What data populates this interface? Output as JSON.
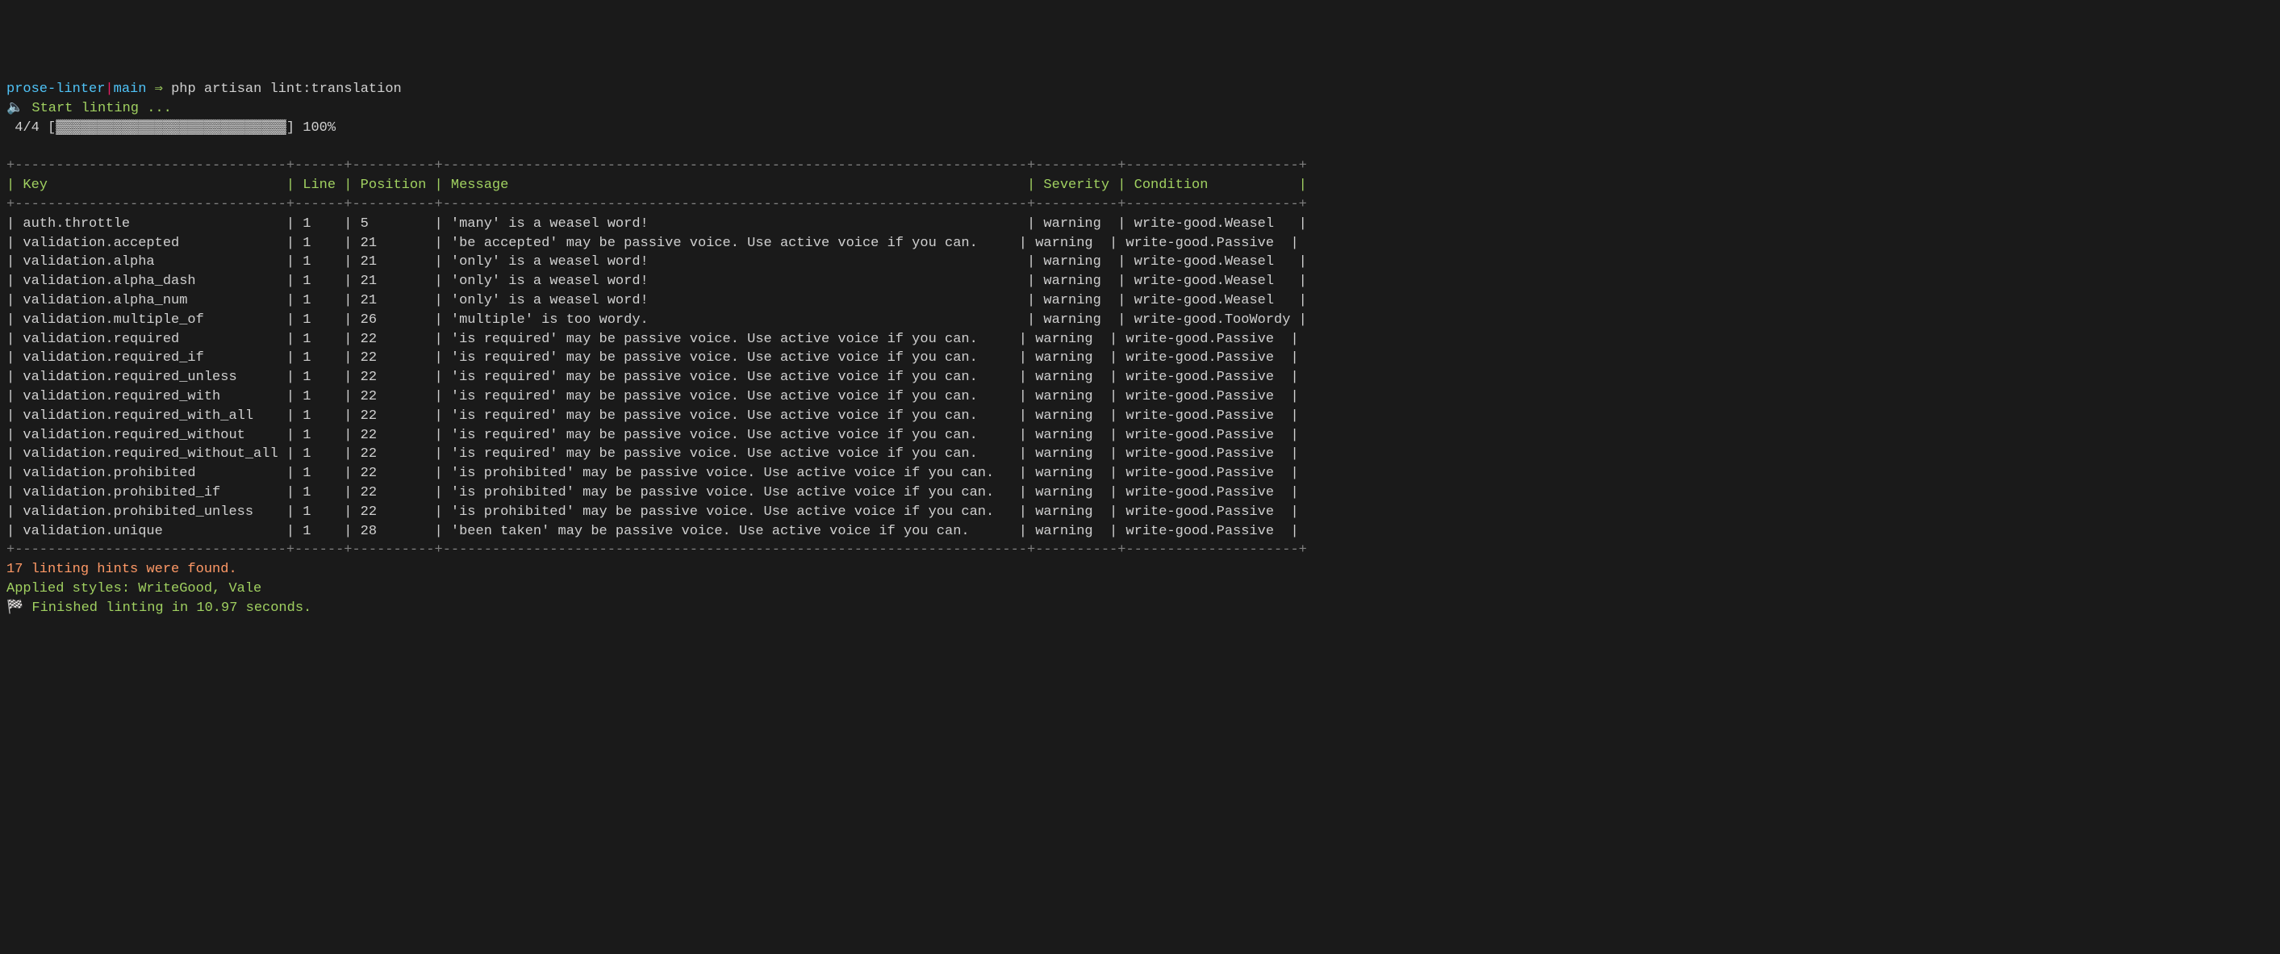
{
  "prompt": {
    "dir": "prose-linter",
    "pipe": "|",
    "branch": "main",
    "arrow": " ⇒ ",
    "command": "php artisan lint:translation"
  },
  "start": {
    "icon": "🔈",
    "text": " Start linting ..."
  },
  "progress": {
    "count": " 4/4 ",
    "open": "[",
    "fill": "▓▓▓▓▓▓▓▓▓▓▓▓▓▓▓▓▓▓▓▓▓▓▓▓▓▓▓▓",
    "close": "]",
    "percent": " 100%"
  },
  "table": {
    "top_border": "+---------------------------------+------+----------+-----------------------------------------------------------------------+----------+---------------------+",
    "header_row": "| Key                             | Line | Position | Message                                                               | Severity | Condition           |",
    "mid_border": "+---------------------------------+------+----------+-----------------------------------------------------------------------+----------+---------------------+",
    "rows": [
      "| auth.throttle                   | 1    | 5        | 'many' is a weasel word!                                              | warning  | write-good.Weasel   |",
      "| validation.accepted             | 1    | 21       | 'be accepted' may be passive voice. Use active voice if you can.     | warning  | write-good.Passive  |",
      "| validation.alpha                | 1    | 21       | 'only' is a weasel word!                                              | warning  | write-good.Weasel   |",
      "| validation.alpha_dash           | 1    | 21       | 'only' is a weasel word!                                              | warning  | write-good.Weasel   |",
      "| validation.alpha_num            | 1    | 21       | 'only' is a weasel word!                                              | warning  | write-good.Weasel   |",
      "| validation.multiple_of          | 1    | 26       | 'multiple' is too wordy.                                              | warning  | write-good.TooWordy |",
      "| validation.required             | 1    | 22       | 'is required' may be passive voice. Use active voice if you can.     | warning  | write-good.Passive  |",
      "| validation.required_if          | 1    | 22       | 'is required' may be passive voice. Use active voice if you can.     | warning  | write-good.Passive  |",
      "| validation.required_unless      | 1    | 22       | 'is required' may be passive voice. Use active voice if you can.     | warning  | write-good.Passive  |",
      "| validation.required_with        | 1    | 22       | 'is required' may be passive voice. Use active voice if you can.     | warning  | write-good.Passive  |",
      "| validation.required_with_all    | 1    | 22       | 'is required' may be passive voice. Use active voice if you can.     | warning  | write-good.Passive  |",
      "| validation.required_without     | 1    | 22       | 'is required' may be passive voice. Use active voice if you can.     | warning  | write-good.Passive  |",
      "| validation.required_without_all | 1    | 22       | 'is required' may be passive voice. Use active voice if you can.     | warning  | write-good.Passive  |",
      "| validation.prohibited           | 1    | 22       | 'is prohibited' may be passive voice. Use active voice if you can.   | warning  | write-good.Passive  |",
      "| validation.prohibited_if        | 1    | 22       | 'is prohibited' may be passive voice. Use active voice if you can.   | warning  | write-good.Passive  |",
      "| validation.prohibited_unless    | 1    | 22       | 'is prohibited' may be passive voice. Use active voice if you can.   | warning  | write-good.Passive  |",
      "| validation.unique               | 1    | 28       | 'been taken' may be passive voice. Use active voice if you can.      | warning  | write-good.Passive  |"
    ],
    "bottom_border": "+---------------------------------+------+----------+-----------------------------------------------------------------------+----------+---------------------+"
  },
  "summary": {
    "hints": "17 linting hints were found.",
    "styles": "Applied styles: WriteGood, Vale",
    "finished_icon": "🏁",
    "finished": " Finished linting in 10.97 seconds."
  }
}
